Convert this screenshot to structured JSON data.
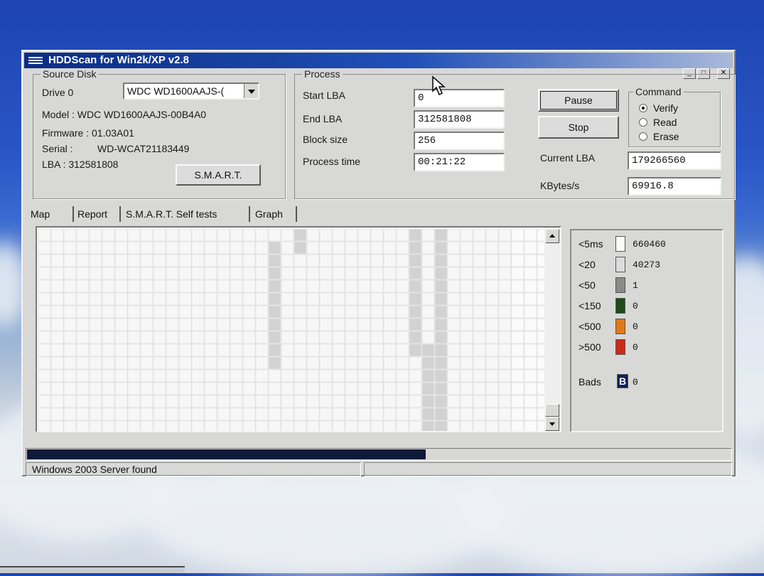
{
  "window": {
    "title": "HDDScan for Win2k/XP  v2.8"
  },
  "source_disk": {
    "group_label": "Source Disk",
    "drive_label": "Drive  0",
    "drive_select_value": "WDC WD1600AAJS-(",
    "model": "Model : WDC WD1600AAJS-00B4A0",
    "firmware": "Firmware : 01.03A01",
    "serial_label": "Serial :",
    "serial_value": "WD-WCAT21183449",
    "lba": "LBA :  312581808",
    "smart_button": "S.M.A.R.T."
  },
  "process": {
    "group_label": "Process",
    "start_lba_label": "Start LBA",
    "start_lba_value": "0",
    "end_lba_label": "End LBA",
    "end_lba_value": "312581808",
    "block_size_label": "Block size",
    "block_size_value": "256",
    "process_time_label": "Process time",
    "process_time_value": "00:21:22",
    "pause_button": "Pause",
    "stop_button": "Stop",
    "current_lba_label": "Current LBA",
    "current_lba_value": "179266560",
    "kbytes_label": "KBytes/s",
    "kbytes_value": "69916.8"
  },
  "command": {
    "group_label": "Command",
    "options": [
      "Verify",
      "Read",
      "Erase"
    ],
    "selected": "Verify"
  },
  "tabs": [
    "Map",
    "Report",
    "S.M.A.R.T. Self tests",
    "Graph"
  ],
  "active_tab": "Map",
  "legend": [
    {
      "label": "<5ms",
      "count": "660460",
      "color": "#fbfbfb"
    },
    {
      "label": "<20",
      "count": "40273",
      "color": "#dcdcdc"
    },
    {
      "label": "<50",
      "count": "1",
      "color": "#8a8a8a"
    },
    {
      "label": "<150",
      "count": "0",
      "color": "#1f4a1a"
    },
    {
      "label": "<500",
      "count": "0",
      "color": "#e07a18"
    },
    {
      "label": ">500",
      "count": "0",
      "color": "#cc2a18"
    }
  ],
  "bads": {
    "label": "Bads",
    "icon_letter": "B",
    "count": "0",
    "color": "#10205a"
  },
  "progress": {
    "fraction": 0.567
  },
  "status": {
    "message": "Windows 2003 Server found",
    "second_pane": ""
  }
}
